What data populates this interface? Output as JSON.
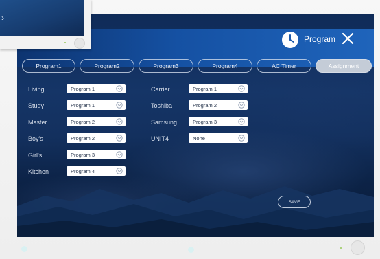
{
  "header": {
    "title": "Program",
    "icons": {
      "clock": "clock-icon",
      "close": "close-icon"
    }
  },
  "tabs": [
    {
      "label": "Program1",
      "active": false
    },
    {
      "label": "Program2",
      "active": false
    },
    {
      "label": "Program3",
      "active": false
    },
    {
      "label": "Program4",
      "active": false
    },
    {
      "label": "AC Timer",
      "active": false
    },
    {
      "label": "Assignment",
      "active": true
    }
  ],
  "assignments_left": [
    {
      "room": "Living",
      "value": "Program 1"
    },
    {
      "room": "Study",
      "value": "Program 1"
    },
    {
      "room": "Master",
      "value": "Program 2"
    },
    {
      "room": "Boy's",
      "value": "Program 2"
    },
    {
      "room": "Girl's",
      "value": "Program 3"
    },
    {
      "room": "Kitchen",
      "value": "Program 4"
    }
  ],
  "assignments_right": [
    {
      "room": "Carrier",
      "value": "Program 1"
    },
    {
      "room": "Toshiba",
      "value": "Program 2"
    },
    {
      "room": "Samsung",
      "value": "Program 3"
    },
    {
      "room": "UNIT4",
      "value": "None"
    }
  ],
  "actions": {
    "save_label": "SAVE"
  },
  "colors": {
    "header_start": "#0d3470",
    "header_end": "#1f64bb",
    "active_tab": "#c4ccd7",
    "text": "#d7deea"
  }
}
